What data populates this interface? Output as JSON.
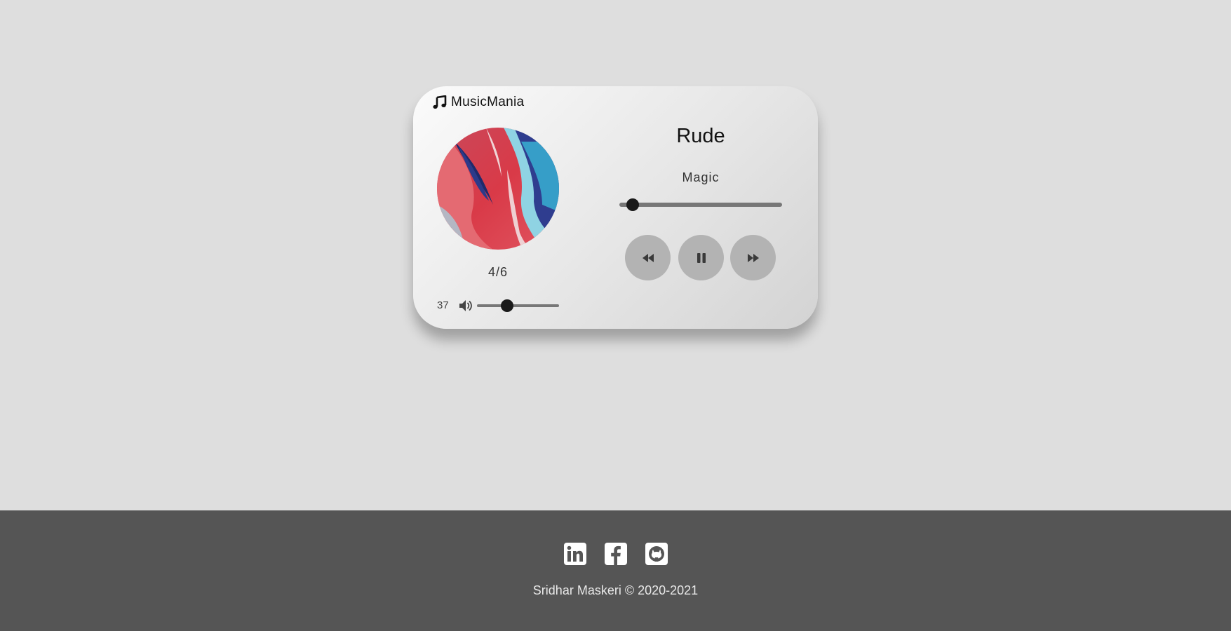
{
  "app": {
    "name": "MusicMania",
    "logo_icon": "music-note-icon"
  },
  "player": {
    "title": "Rude",
    "artist": "Magic",
    "track_counter": "4/6",
    "progress_fraction": 0.08,
    "volume": {
      "value": "37",
      "level": 0.37,
      "icon": "volume-up-icon"
    },
    "controls": [
      {
        "name": "previous",
        "icon": "backward-icon"
      },
      {
        "name": "pause",
        "icon": "pause-icon"
      },
      {
        "name": "next",
        "icon": "forward-icon"
      }
    ]
  },
  "footer": {
    "social": [
      {
        "name": "linkedin",
        "icon": "linkedin-icon"
      },
      {
        "name": "facebook",
        "icon": "facebook-icon"
      },
      {
        "name": "github",
        "icon": "github-icon"
      }
    ],
    "credit": "Sridhar Maskeri © 2020-2021"
  },
  "colors": {
    "background": "#dedede",
    "footer": "#555555",
    "control_button": "#b3b3b3",
    "slider_thumb": "#1a1a1a"
  }
}
